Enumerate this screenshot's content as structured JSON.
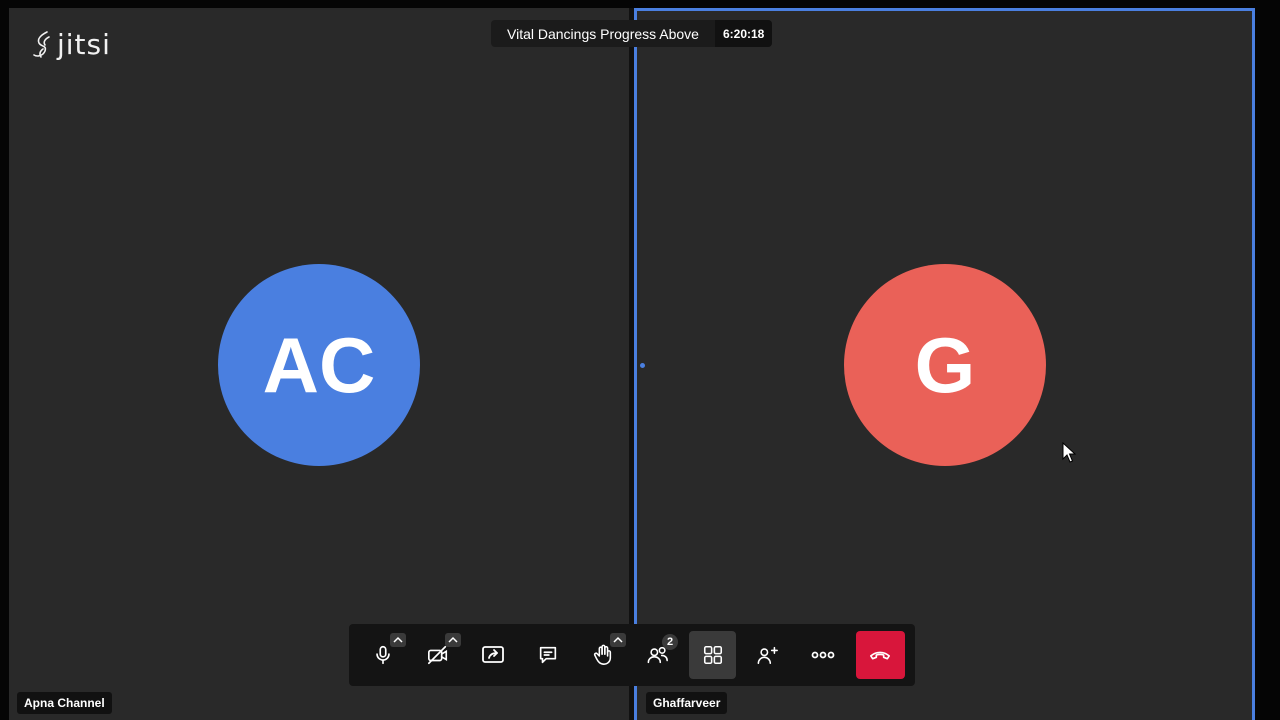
{
  "app": {
    "logo_text": "jitsi",
    "meeting_title": "Vital Dancings Progress Above",
    "meeting_timer": "6:20:18"
  },
  "participants": [
    {
      "name": "Apna Channel",
      "initials": "AC",
      "avatar_color": "#4a7fe0"
    },
    {
      "name": "Ghaffarveer",
      "initials": "G",
      "avatar_color": "#ea6158"
    }
  ],
  "toolbar": {
    "participants_count": "2",
    "buttons": [
      {
        "icon": "microphone-icon",
        "has_caret": true
      },
      {
        "icon": "camera-off-icon",
        "has_caret": true
      },
      {
        "icon": "screen-share-icon"
      },
      {
        "icon": "chat-icon"
      },
      {
        "icon": "raise-hand-icon",
        "has_caret": true
      },
      {
        "icon": "participants-icon"
      },
      {
        "icon": "tile-view-icon",
        "active": true
      },
      {
        "icon": "invite-icon"
      },
      {
        "icon": "more-icon"
      },
      {
        "icon": "hangup-icon"
      }
    ]
  },
  "colors": {
    "accent": "#4a7fe0",
    "hangup": "#d8163b",
    "tile_background": "#292929"
  }
}
